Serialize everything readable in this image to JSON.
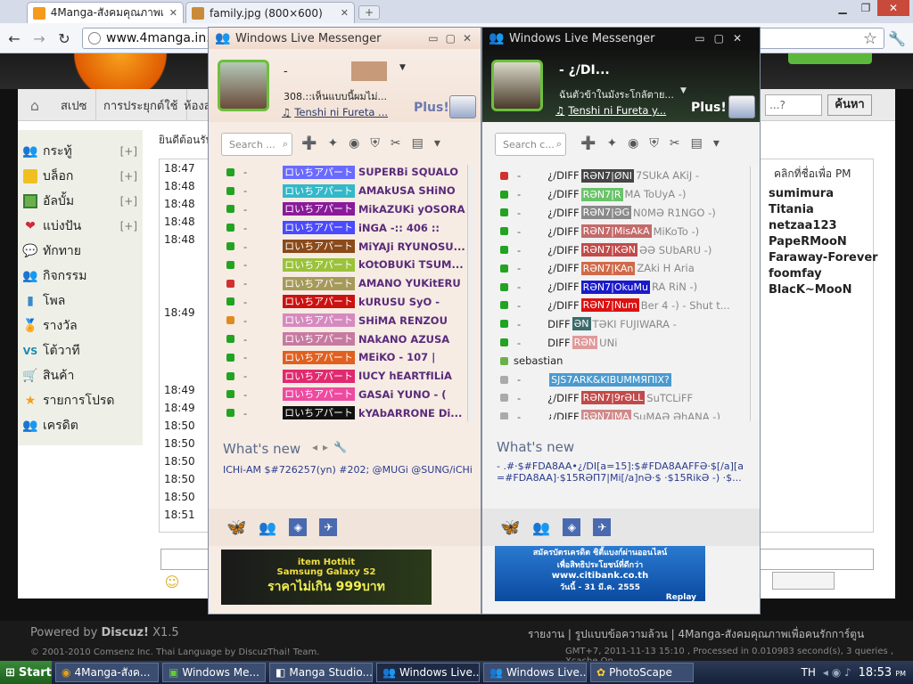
{
  "browser": {
    "tabs": [
      {
        "title": "4Manga-สังคมคุณภาพเพื่อคนรัก",
        "active": true
      },
      {
        "title": "family.jpg (800×600)",
        "active": false
      }
    ],
    "url": "www.4manga.in.th"
  },
  "forum": {
    "breadcrumb": [
      "สเปซ",
      "การประยุกต์ใช้",
      "ห้องส"
    ],
    "welcome_text": "ยินดีต้อนรับ",
    "sidebar": [
      {
        "label": "กระทู้",
        "icon": "thread-icon",
        "plus": "[+]"
      },
      {
        "label": "บล็อก",
        "icon": "blog-icon",
        "plus": "[+]"
      },
      {
        "label": "อัลบั้ม",
        "icon": "album-icon",
        "plus": "[+]"
      },
      {
        "label": "แบ่งปัน",
        "icon": "heart-icon",
        "plus": "[+]"
      },
      {
        "label": "ทักทาย",
        "icon": "chat-bubble-icon",
        "plus": ""
      },
      {
        "label": "กิจกรรม",
        "icon": "people-icon",
        "plus": ""
      },
      {
        "label": "โพล",
        "icon": "poll-icon",
        "plus": ""
      },
      {
        "label": "รางวัล",
        "icon": "award-icon",
        "plus": ""
      },
      {
        "label": "โต้วาที",
        "icon": "vs-icon",
        "plus": ""
      },
      {
        "label": "สินค้า",
        "icon": "cart-icon",
        "plus": ""
      },
      {
        "label": "รายการโปรด",
        "icon": "star-icon",
        "plus": ""
      },
      {
        "label": "เครดิต",
        "icon": "credit-icon",
        "plus": ""
      }
    ],
    "chat_times": [
      "18:47",
      "18:48",
      "18:48",
      "18:48",
      "18:48",
      "18:49",
      "18:49",
      "18:49",
      "18:50",
      "18:50",
      "18:50",
      "18:50",
      "18:50",
      "18:51"
    ],
    "search_button": "ค้นหา",
    "userlist_header": "คลิกที่ชื่อเพื่อ PM",
    "users": [
      "sumimura",
      "Titania",
      "netzaa123",
      "PapeRMooN",
      "Faraway-Forever",
      "foomfay",
      "BlacK~MooN"
    ],
    "footer": {
      "powered": "Powered by",
      "brand": "Discuz!",
      "version": "X1.5",
      "copyright": "© 2001-2010 Comsenz Inc. Thai Language by DiscuzThai! Team.",
      "links": "รายงาน | รูปแบบข้อความล้วน | 4Manga-สังคมคุณภาพเพื่อคนรักการ์ตูน",
      "stats": "GMT+7, 2011-11-13 15:10 , Processed in 0.010983 second(s), 3 queries , Xcache On."
    }
  },
  "wlm1": {
    "title": "Windows Live Messenger",
    "name": "-",
    "personal_message": "308.::เห็นแบบนี้ผมไม่...",
    "now_playing": "Tenshi ni Fureta ...",
    "plus_label": "Plus!",
    "search_placeholder": "Search ...",
    "contacts": [
      {
        "group": "ロいちアパート",
        "name": "SUPERBi SQUALO",
        "tag_color": "#6a6aff",
        "status": "#22a322"
      },
      {
        "group": "ロいちアパート",
        "name": "AMAkUSA SHiNO",
        "tag_color": "#33b8c9",
        "status": "#22a322"
      },
      {
        "group": "ロいちアパート",
        "name": "MikAZUKi yOSORA",
        "tag_color": "#8a1a9a",
        "status": "#22a322"
      },
      {
        "group": "ロいちアパート",
        "name": "iNGA -:: 406 ::",
        "tag_color": "#4a4aff",
        "status": "#22a322"
      },
      {
        "group": "ロいちアパート",
        "name": "MiYAJi RYUNOSU...",
        "tag_color": "#8a4a1a",
        "status": "#22a322"
      },
      {
        "group": "ロいちアパート",
        "name": "kOtOBUKi TSUM...",
        "tag_color": "#9ac23a",
        "status": "#22a322"
      },
      {
        "group": "ロいちアパート",
        "name": "AMANO YUKitERU",
        "tag_color": "#a69a5a",
        "status": "#d03030"
      },
      {
        "group": "ロいちアパート",
        "name": "kURUSU SyO -",
        "tag_color": "#cc1111",
        "status": "#22a322"
      },
      {
        "group": "ロいちアパート",
        "name": "SHiMA RENZOU",
        "tag_color": "#d58abf",
        "status": "#e08a20"
      },
      {
        "group": "ロいちアパート",
        "name": "NAkANO AZUSA",
        "tag_color": "#c77aa0",
        "status": "#22a322"
      },
      {
        "group": "ロいちアパート",
        "name": "MEiKO - 107 |",
        "tag_color": "#e06020",
        "status": "#22a322"
      },
      {
        "group": "ロいちアパート",
        "name": "IUCY hEARTfILiA",
        "tag_color": "#e02a70",
        "status": "#22a322"
      },
      {
        "group": "ロいちアパート",
        "name": "GASAi YUNO - (",
        "tag_color": "#ee4aa0",
        "status": "#22a322"
      },
      {
        "group": "ロいちアパート",
        "name": "kYAbARRONE Di...",
        "tag_color": "#111111",
        "status": "#22a322"
      }
    ],
    "whats_new": "What's new",
    "whats_new_item": "ICHi-AM  $#726257(yn) #202; @MUGi @SUNG/iCHi # ...",
    "ad_line1": "item Hothit",
    "ad_line2": "Samsung Galaxy S2",
    "ad_line3": "ราคาไม่เกิน 999บาท"
  },
  "wlm2": {
    "title": "Windows Live Messenger",
    "name": "- ¿/DI...",
    "personal_message": "ฉันตัวข้าในมังระโกลัตาย...",
    "now_playing": "Tenshi ni Fureta y...",
    "plus_label": "Plus!",
    "search_placeholder": "Search c...",
    "contacts": [
      {
        "prefix": "¿/DIFF",
        "tag": "RƏN7|ØNI",
        "rest": "7SUkA AKiJ -",
        "tag_color": "#444444",
        "status": "#d03030"
      },
      {
        "prefix": "¿/DIFF",
        "tag": "RƏN7|R",
        "rest": "MA ToUyA -)",
        "tag_color": "#6ac36a",
        "status": "#22a322"
      },
      {
        "prefix": "¿/DIFF",
        "tag": "RƏN7|ƏG",
        "rest": "N0MƏ R1NGO -)",
        "tag_color": "#8a8a8a",
        "status": "#22a322"
      },
      {
        "prefix": "¿/DIFF",
        "tag": "RƏN7|MisAkA",
        "rest": "MiKoTo -)",
        "tag_color": "#c46a6a",
        "status": "#22a322"
      },
      {
        "prefix": "¿/DIFF",
        "tag": "RƏN7|KƏN",
        "rest": "ƏƏ SUbARU -)",
        "tag_color": "#c24a4a",
        "status": "#22a322"
      },
      {
        "prefix": "¿/DIFF",
        "tag": "RƏN7|KAn",
        "rest": "ZAki H Aria",
        "tag_color": "#d06a4a",
        "status": "#22a322"
      },
      {
        "prefix": "¿/DIFF",
        "tag": "RƏN7|OkuMu",
        "rest": "RA RiN -)",
        "tag_color": "#1a1acc",
        "status": "#22a322"
      },
      {
        "prefix": "¿/DIFF",
        "tag": "RƏN7|Num",
        "rest": "Ber 4 -) - Shut t...",
        "tag_color": "#dd1111",
        "status": "#22a322"
      },
      {
        "prefix": "DIFF",
        "tag": "ƏN",
        "rest": "TƏKI FUJIWARA -",
        "tag_color": "#3a6a6a",
        "status": "#22a322"
      },
      {
        "prefix": "DIFF",
        "tag": "RƏN",
        "rest": "UNi",
        "tag_color": "#e09a9a",
        "status": "#22a322"
      }
    ],
    "group_label": "sebastian",
    "group_contacts": [
      {
        "prefix": "",
        "tag": "SJS7ARK&KIBUMMЯПIX?",
        "rest": "",
        "tag_color": "#4a9ad0",
        "status": "#aaaaaa"
      },
      {
        "prefix": "¿/DIFF",
        "tag": "RƏN7|9rƏLL",
        "rest": "SuTCLiFF",
        "tag_color": "#c04a4a",
        "status": "#aaaaaa"
      },
      {
        "prefix": "¿/DIFF",
        "tag": "RƏN7|MA",
        "rest": "SuMAƏ ƏhANA -)",
        "tag_color": "#d08a8a",
        "status": "#aaaaaa"
      }
    ],
    "whats_new": "What's new",
    "whats_new_item": "- .#·$#FDA8AA•¿/DI[a=15]:$#FDA8AAFFƏ·$[/a][a=#FDA8AA]·$15RƏП7|Mi[/a]nƏ·$ ·$15RikƏ -) ·$...",
    "ad_line1": "สมัครบัตรเครดิต ซิตี้แบงก์ผ่านออนไลน์",
    "ad_line2": "เพื่อสิทธิประโยชน์ที่ดีกว่า",
    "ad_line3": "www.citibank.co.th",
    "ad_line4": "วันนี้ - 31 มี.ค. 2555",
    "ad_replay": "Replay"
  },
  "taskbar": {
    "start": "Start",
    "items": [
      {
        "label": "4Manga-สังค...",
        "active": false
      },
      {
        "label": "Windows Me...",
        "active": false
      },
      {
        "label": "Manga Studio...",
        "active": false
      },
      {
        "label": "Windows Live...",
        "active": true
      },
      {
        "label": "Windows Live...",
        "active": false
      },
      {
        "label": "PhotoScape",
        "active": false
      }
    ],
    "lang": "TH",
    "time": "18:53",
    "ampm": "PM"
  }
}
